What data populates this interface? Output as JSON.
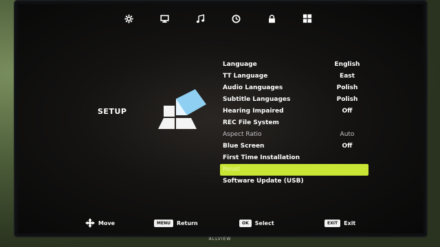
{
  "brand": "ALLVIEW",
  "topbar": {
    "items": [
      {
        "icon": "gear-icon",
        "glyph": "✲"
      },
      {
        "icon": "monitor-icon",
        "glyph": "🖵"
      },
      {
        "icon": "music-icon",
        "glyph": "♫"
      },
      {
        "icon": "clock-icon",
        "glyph": "◷"
      },
      {
        "icon": "lock-icon",
        "glyph": "🔒"
      },
      {
        "icon": "grid-icon",
        "glyph": "▦"
      }
    ]
  },
  "setup": {
    "title": "SETUP"
  },
  "menu": {
    "items": [
      {
        "label": "Language",
        "value": "English"
      },
      {
        "label": "TT Language",
        "value": "East"
      },
      {
        "label": "Audio Languages",
        "value": "Polish"
      },
      {
        "label": "Subtitle Languages",
        "value": "Polish"
      },
      {
        "label": "Hearing Impaired",
        "value": "Off"
      },
      {
        "label": "REC File System",
        "value": ""
      },
      {
        "label": "Aspect Ratio",
        "value": "Auto"
      },
      {
        "label": "Blue Screen",
        "value": "Off"
      },
      {
        "label": "First Time Installation",
        "value": ""
      },
      {
        "label": "Reset",
        "value": ""
      },
      {
        "label": "Software Update (USB)",
        "value": ""
      }
    ],
    "selected_index": 9
  },
  "footer": {
    "move_label": "Move",
    "menu_key": "MENU",
    "return_label": "Return",
    "ok_key": "OK",
    "select_label": "Select",
    "exit_key": "EXIT",
    "exit_label": "Exit"
  },
  "colors": {
    "highlight": "#c9e635",
    "logo_accent": "#8fd0f2"
  }
}
